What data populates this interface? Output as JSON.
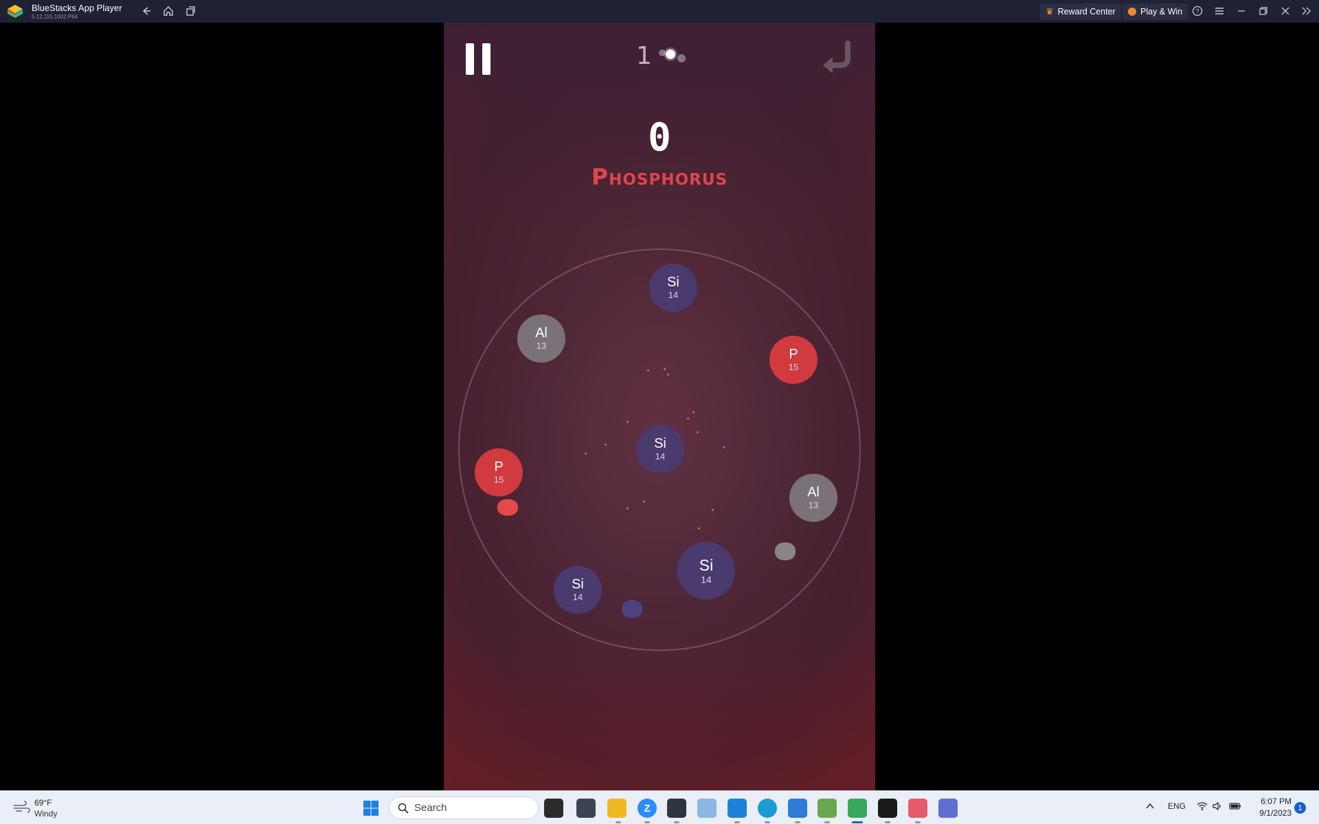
{
  "titlebar": {
    "title": "BlueStacks App Player",
    "version": "5.12.115.1002  P64",
    "reward_center": "Reward Center",
    "play_win": "Play & Win"
  },
  "game": {
    "level": "1",
    "score": "0",
    "element_name": "Phosphorus",
    "atoms": [
      {
        "symbol": "Si",
        "number": "14",
        "kind": "si"
      },
      {
        "symbol": "Al",
        "number": "13",
        "kind": "al"
      },
      {
        "symbol": "P",
        "number": "15",
        "kind": "p"
      },
      {
        "symbol": "Si",
        "number": "14",
        "kind": "si"
      },
      {
        "symbol": "P",
        "number": "15",
        "kind": "p"
      },
      {
        "symbol": "Al",
        "number": "13",
        "kind": "al"
      },
      {
        "symbol": "Si",
        "number": "14",
        "kind": "si"
      },
      {
        "symbol": "Si",
        "number": "14",
        "kind": "si"
      }
    ],
    "colors": {
      "silicon": "#4a3a6e",
      "aluminium": "#7a7278",
      "phosphorus": "#d13a3f",
      "title": "#e0454c"
    }
  },
  "taskbar": {
    "weather_temp": "69°F",
    "weather_desc": "Windy",
    "search_placeholder": "Search",
    "language": "ENG",
    "time": "6:07 PM",
    "date": "9/1/2023",
    "notifications": "1",
    "apps": [
      "file-explorer-dark-icon",
      "photo-viewer-icon",
      "folder-icon",
      "zoom-icon",
      "terminal-icon",
      "photos-icon",
      "vscode-icon",
      "edge-icon",
      "paint-icon",
      "notepad-icon",
      "bluestacks-icon",
      "cmd-icon",
      "snipping-tool-icon",
      "app-icon"
    ]
  }
}
